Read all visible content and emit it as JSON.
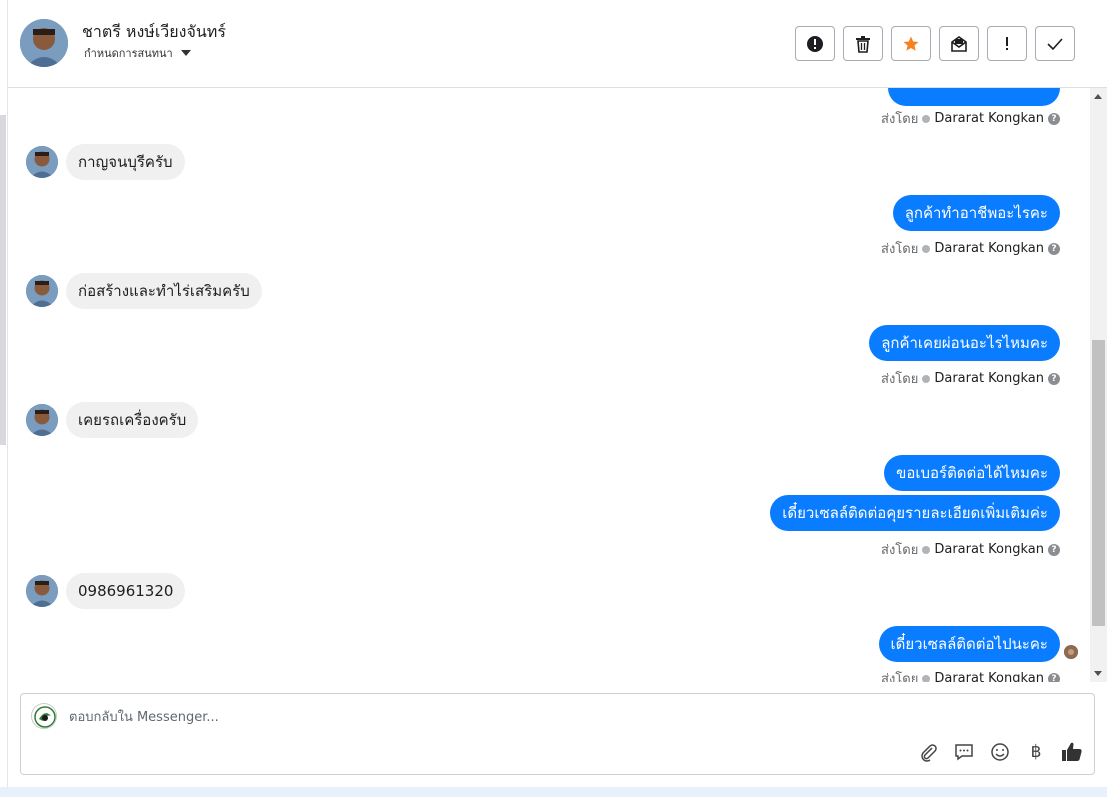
{
  "header": {
    "contact_name": "ชาตรี หงษ์เวียงจันทร์",
    "subtitle": "กำหนดการสนทนา",
    "actions": [
      {
        "icon": "alert-circle-icon",
        "name": "spam-button"
      },
      {
        "icon": "trash-icon",
        "name": "delete-button"
      },
      {
        "icon": "star-icon",
        "name": "star-button"
      },
      {
        "icon": "mail-icon",
        "name": "mark-unread-button"
      },
      {
        "icon": "exclamation-icon",
        "name": "important-button"
      },
      {
        "icon": "check-icon",
        "name": "done-button"
      }
    ]
  },
  "messages": {
    "sent_by_label": "ส่งโดย",
    "agent_name": "Dararat Kongkan",
    "items": [
      {
        "type": "sent-by"
      },
      {
        "type": "in",
        "text": "กาญจนบุรีครับ"
      },
      {
        "type": "out",
        "text": "ลูกค้าทำอาชีพอะไรคะ"
      },
      {
        "type": "sent-by"
      },
      {
        "type": "in",
        "text": "ก่อสร้างและทำไร่เสริมครับ"
      },
      {
        "type": "out",
        "text": "ลูกค้าเคยผ่อนอะไรไหมคะ"
      },
      {
        "type": "sent-by"
      },
      {
        "type": "in",
        "text": "เคยรถเครื่องครับ"
      },
      {
        "type": "out",
        "text": "ขอเบอร์ติดต่อได้ไหมคะ"
      },
      {
        "type": "out",
        "text": "เดี๋ยวเซลล์ติดต่อคุยรายละเอียดเพิ่มเติมค่ะ"
      },
      {
        "type": "sent-by"
      },
      {
        "type": "in",
        "text": "0986961320"
      },
      {
        "type": "out",
        "text": "เดี๋ยวเซลล์ติดต่อไปนะคะ"
      },
      {
        "type": "sent-by"
      }
    ]
  },
  "composer": {
    "placeholder": "ตอบกลับใน Messenger...",
    "tools": [
      "attach-icon",
      "chat-bubble-icon",
      "emoji-icon",
      "baht-icon",
      "thumbs-up-icon"
    ],
    "baht_symbol": "฿"
  },
  "colors": {
    "outgoing_bubble": "#0a7cff",
    "incoming_bubble": "#f0f0f0",
    "star": "#f5821f"
  }
}
